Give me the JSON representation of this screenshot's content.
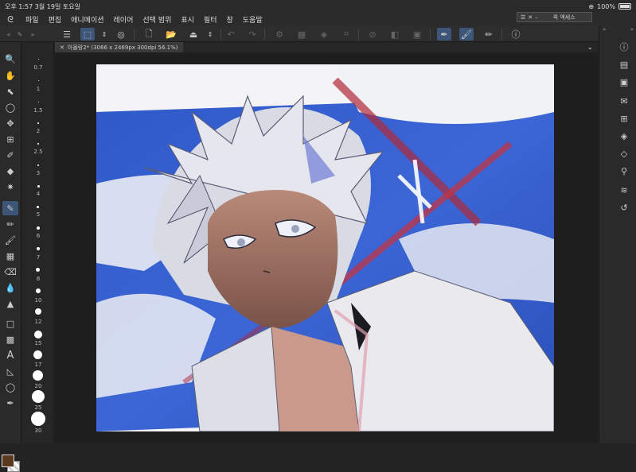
{
  "status_bar": {
    "time": "오후 1:57",
    "date": "3월 19일 토요일",
    "battery": "100%"
  },
  "menu": {
    "items": [
      "파일",
      "편집",
      "애니메이션",
      "레이어",
      "선택 범위",
      "표시",
      "필터",
      "창",
      "도움말"
    ]
  },
  "quick_access": {
    "label": "퀵 액세스"
  },
  "document": {
    "tab_label": "아몰랑2* (3066 x 2469px 300dpi 56.1%)"
  },
  "brush_sizes": [
    "0.7",
    "1",
    "1.5",
    "2",
    "2.5",
    "3",
    "4",
    "5",
    "6",
    "7",
    "8",
    "10",
    "12",
    "15",
    "17",
    "20",
    "25",
    "30"
  ],
  "colors": {
    "main_color": "#5a3a1f",
    "accent": "#3d5577"
  }
}
